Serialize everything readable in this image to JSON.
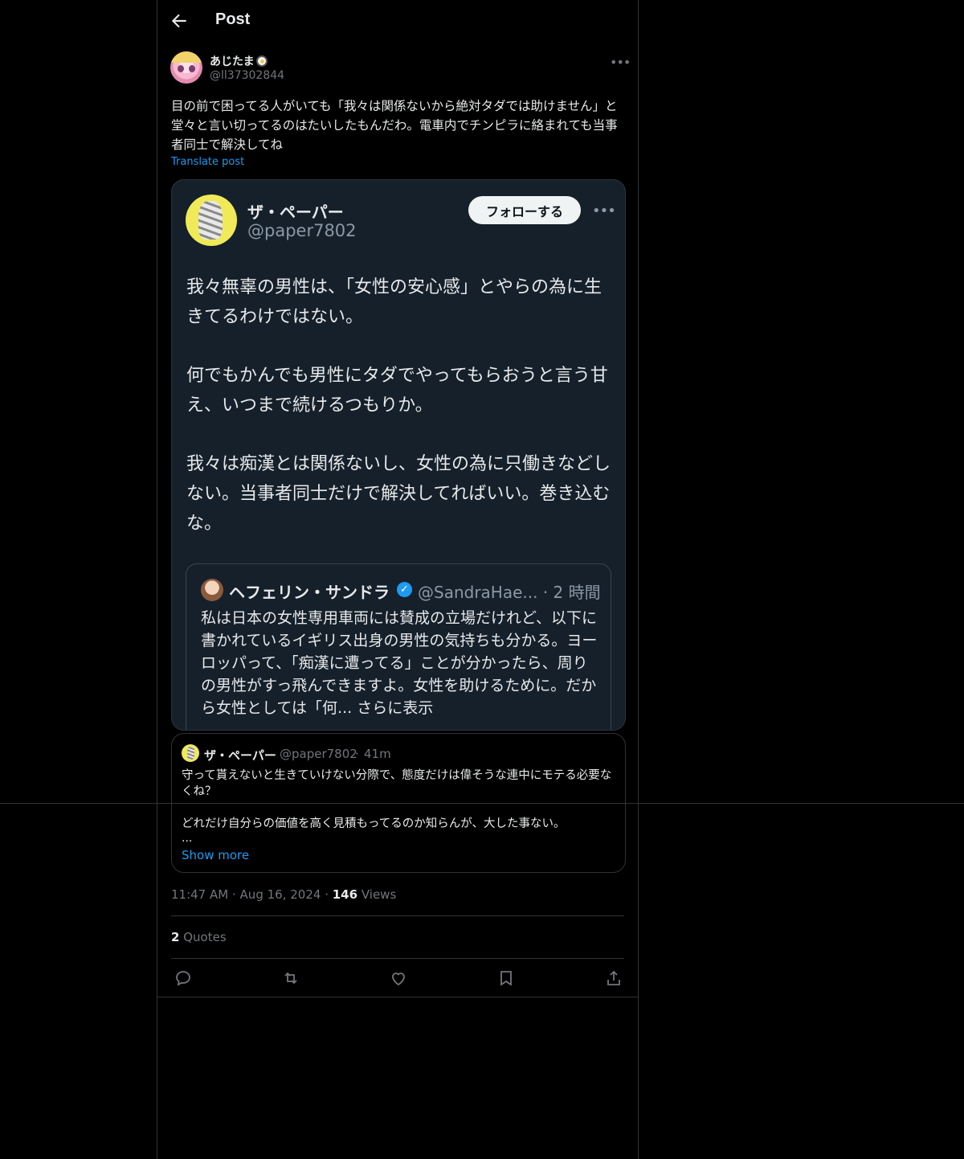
{
  "header": {
    "title": "Post"
  },
  "author": {
    "name": "あじたま",
    "handle": "@ll37302844"
  },
  "tweet": {
    "text": "目の前で困ってる人がいても「我々は関係ないから絶対タダでは助けません」と堂々と言い切ってるのはたいしたもんだわ。電車内でチンピラに絡まれても当事者同士で解決してね",
    "translate_label": "Translate post"
  },
  "media": {
    "name": "ザ・ペーパー",
    "handle": "@paper7802",
    "follow_label": "フォローする",
    "paragraphs": [
      "我々無辜の男性は、「女性の安心感」とやらの為に生きてるわけではない。",
      "何でもかんでも男性にタダでやってもらおうと言う甘え、いつまで続けるつもりか。",
      "我々は痴漢とは関係ないし、女性の為に只働きなどしない。当事者同士だけで解決してればいい。巻き込むな。"
    ],
    "quote": {
      "name": "ヘフェリン・サンドラ",
      "handle_time": "@SandraHae... · 2 時間",
      "text": "私は日本の女性専用車両には賛成の立場だけれど、以下に書かれているイギリス出身の男性の気持ちも分かる。ヨーロッパって、「痴漢に遭ってる」ことが分かったら、周りの男性がすっ飛んできますよ。女性を助けるために。だから女性としては「何... さらに表示"
    }
  },
  "quoted_post": {
    "name": "ザ・ペーパー",
    "handle": "@paper7802",
    "dot": "·",
    "time": "41m",
    "text1": "守って貰えないと生きていけない分際で、態度だけは偉そうな連中にモテる必要なくね？",
    "text2": "どれだけ自分らの価値を高く見積もってるのか知らんが、大した事ない。",
    "ellipsis": "...",
    "show_more": "Show more"
  },
  "meta": {
    "time": "11:47 AM",
    "sep1": "·",
    "date": "Aug 16, 2024",
    "sep2": "·",
    "views_count": "146",
    "views_label": "Views"
  },
  "stats": {
    "quotes_count": "2",
    "quotes_label": "Quotes"
  },
  "icons": [
    "back-arrow-icon",
    "more-icon",
    "reply-icon",
    "retweet-icon",
    "like-icon",
    "bookmark-icon",
    "share-icon",
    "verified-icon"
  ],
  "colors": {
    "background": "#000000",
    "text": "#e7e9ea",
    "muted": "#71767b",
    "link": "#1d9bf0",
    "border": "#2f3336",
    "media_bg": "#15202b"
  }
}
